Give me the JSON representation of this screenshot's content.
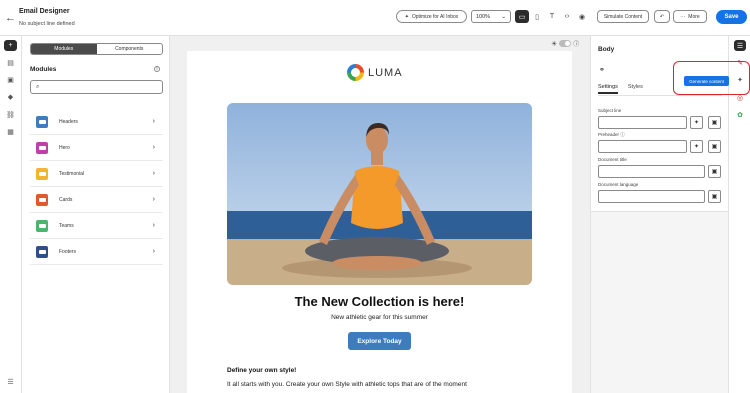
{
  "header": {
    "title": "Email Designer",
    "subtitle": "No subject line defined",
    "optimize_label": "Optimize for AI Inbox",
    "zoom": "100%",
    "simulate_label": "Simulate Content",
    "more_label": "More",
    "save_label": "Save"
  },
  "modules_panel": {
    "tabs": [
      "Modules",
      "Components"
    ],
    "active_tab": "Modules",
    "title": "Modules",
    "search_placeholder": "",
    "items": [
      {
        "label": "Headers",
        "color": "#3f7bbd"
      },
      {
        "label": "Hero",
        "color": "#c23fa8"
      },
      {
        "label": "Testimonial",
        "color": "#f2b431"
      },
      {
        "label": "Cards",
        "color": "#e2582f"
      },
      {
        "label": "Teams",
        "color": "#4bb56b"
      },
      {
        "label": "Footers",
        "color": "#2f4f86"
      }
    ]
  },
  "email": {
    "brand": "LUMA",
    "headline": "The New Collection is here!",
    "tagline": "New athletic gear for this summer",
    "cta": "Explore Today",
    "section_title": "Define your own style!",
    "section_body": "It all starts with you. Create your own Style with athletic tops that are of the moment"
  },
  "properties": {
    "title": "Body",
    "tabs": [
      "Settings",
      "Styles"
    ],
    "active_tab": "Settings",
    "fields": [
      {
        "label": "Subject line"
      },
      {
        "label": "Preheader"
      },
      {
        "label": "Document title"
      },
      {
        "label": "Document language"
      }
    ]
  },
  "tooltip": "Generate content",
  "colors": {
    "accent": "#1473e6",
    "highlight": "#e0242d",
    "cta": "#3f7bbd"
  }
}
